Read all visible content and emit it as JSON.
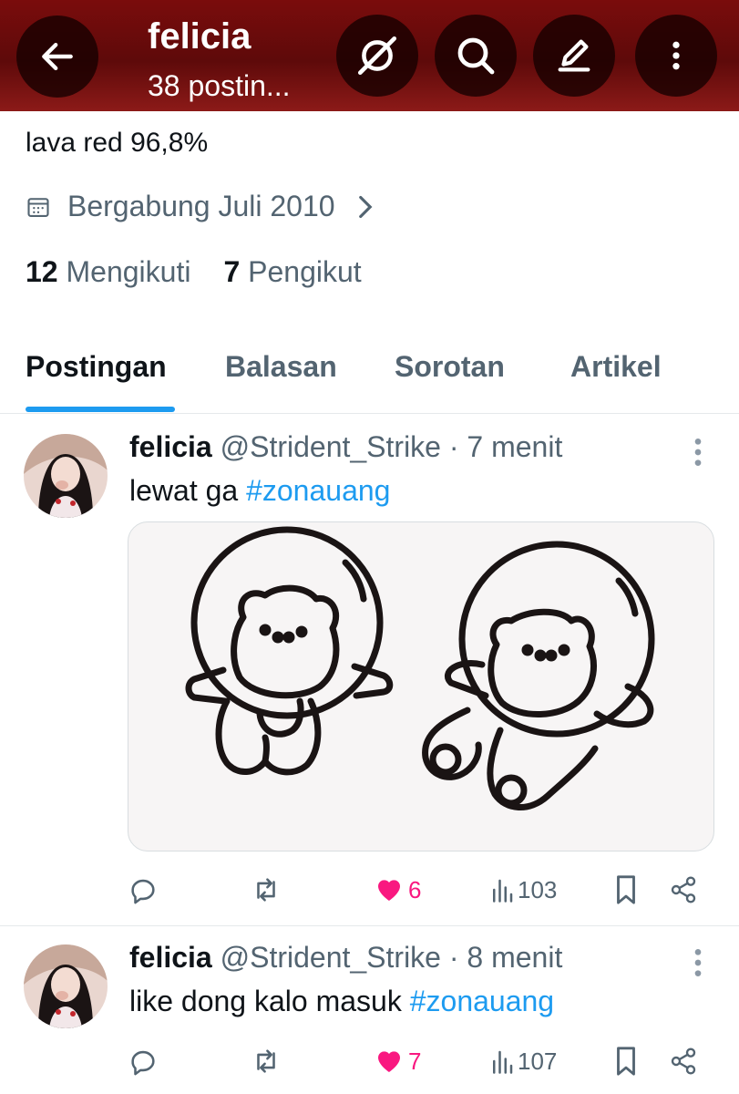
{
  "header": {
    "title": "felicia",
    "subtitle": "38 postin...",
    "icons": [
      "arrow-left-icon",
      "no-image-icon",
      "search-icon",
      "edit-icon",
      "more-vertical-icon"
    ]
  },
  "profile": {
    "bio": "lava red 96,8%",
    "joined": "Bergabung Juli 2010",
    "following_count": "12",
    "following_label": "Mengikuti",
    "followers_count": "7",
    "followers_label": "Pengikut"
  },
  "tabs": [
    {
      "label": "Postingan",
      "active": true
    },
    {
      "label": "Balasan",
      "active": false
    },
    {
      "label": "Sorotan",
      "active": false
    },
    {
      "label": "Artikel",
      "active": false
    }
  ],
  "posts": [
    {
      "name": "felicia",
      "handle": "@Strident_Strike",
      "time": "· 7 menit",
      "text": "lewat ga ",
      "hashtag": "#zonauang",
      "likes": "6",
      "views": "103"
    },
    {
      "name": "felicia",
      "handle": "@Strident_Strike",
      "time": "· 8 menit",
      "text": "like dong kalo masuk ",
      "hashtag": "#zonauang",
      "likes": "7",
      "views": "107"
    }
  ],
  "colors": {
    "header_bg": "#6b0b0b",
    "accent": "#1d9bf0",
    "like": "#f91880",
    "muted": "#536471"
  }
}
